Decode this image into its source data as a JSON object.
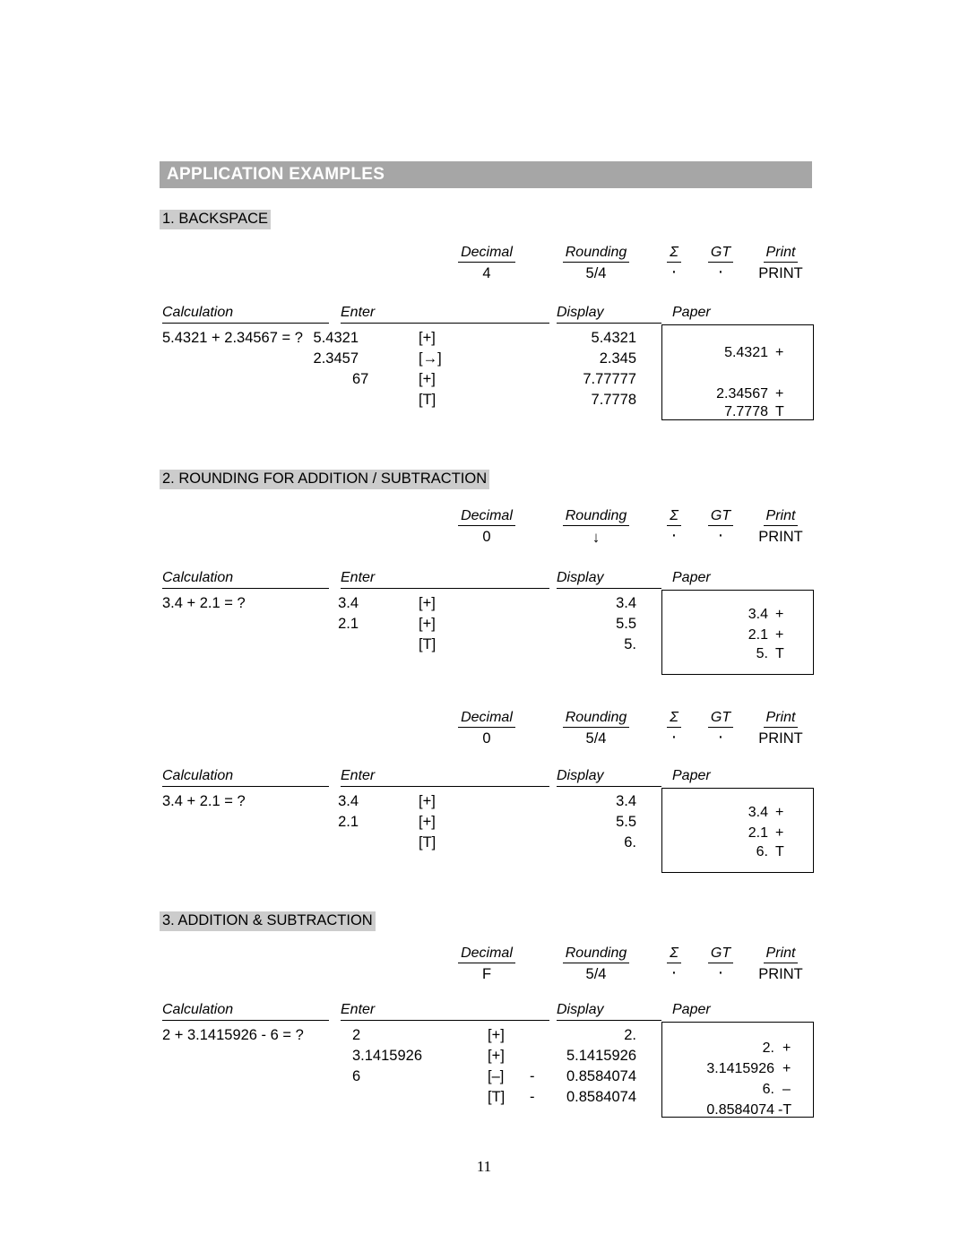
{
  "banner": {
    "title": "APPLICATION EXAMPLES"
  },
  "page_number": "11",
  "column_headers": {
    "calculation": "Calculation",
    "enter": "Enter",
    "display": "Display",
    "paper": "Paper"
  },
  "settings_headers": {
    "decimal": "Decimal",
    "rounding": "Rounding",
    "sigma": "Σ",
    "gt": "GT",
    "print": "Print"
  },
  "sections": [
    {
      "heading": "1. BACKSPACE",
      "blocks": [
        {
          "settings": {
            "decimal": "4",
            "rounding": "5/4",
            "sigma": "·",
            "gt": "·",
            "print": "PRINT"
          },
          "calculation": "5.4321 + 2.34567 = ?",
          "rows": [
            {
              "enter": "5.4321",
              "key": "[+]",
              "display": "5.4321"
            },
            {
              "enter": "2.3457",
              "key": "[→]",
              "display": "2.345"
            },
            {
              "enter": "67",
              "key": "[+]",
              "display": "7.77777"
            },
            {
              "enter": "",
              "key": "[T]",
              "display": "7.7778"
            }
          ],
          "paper": [
            {
              "num": "5.4321",
              "sym": "+"
            },
            {
              "num": "",
              "sym": ""
            },
            {
              "num": "2.34567",
              "sym": "+"
            },
            {
              "num": "7.7778",
              "sym": "T"
            }
          ]
        }
      ]
    },
    {
      "heading": "2. ROUNDING FOR ADDITION / SUBTRACTION",
      "blocks": [
        {
          "settings": {
            "decimal": "0",
            "rounding": "↓",
            "sigma": "·",
            "gt": "·",
            "print": "PRINT"
          },
          "calculation": "3.4 + 2.1 = ?",
          "rows": [
            {
              "enter": "3.4",
              "key": "[+]",
              "display": "3.4"
            },
            {
              "enter": "2.1",
              "key": "[+]",
              "display": "5.5"
            },
            {
              "enter": "",
              "key": "[T]",
              "display": "5."
            }
          ],
          "paper": [
            {
              "num": "3.4",
              "sym": "+"
            },
            {
              "num": "2.1",
              "sym": "+"
            },
            {
              "num": "5.",
              "sym": "T"
            }
          ]
        },
        {
          "settings": {
            "decimal": "0",
            "rounding": "5/4",
            "sigma": "·",
            "gt": "·",
            "print": "PRINT"
          },
          "calculation": "3.4 + 2.1 = ?",
          "rows": [
            {
              "enter": "3.4",
              "key": "[+]",
              "display": "3.4"
            },
            {
              "enter": "2.1",
              "key": "[+]",
              "display": "5.5"
            },
            {
              "enter": "",
              "key": "[T]",
              "display": "6."
            }
          ],
          "paper": [
            {
              "num": "3.4",
              "sym": "+"
            },
            {
              "num": "2.1",
              "sym": "+"
            },
            {
              "num": "6.",
              "sym": "T"
            }
          ]
        }
      ]
    },
    {
      "heading": "3. ADDITION & SUBTRACTION",
      "blocks": [
        {
          "settings": {
            "decimal": "F",
            "rounding": "5/4",
            "sigma": "·",
            "gt": "·",
            "print": "PRINT"
          },
          "calculation": "2 + 3.1415926 - 6 = ?",
          "rows": [
            {
              "enter": "2",
              "key": "[+]",
              "display": "2."
            },
            {
              "enter": "3.1415926",
              "key": "[+]",
              "display": "5.1415926",
              "display_sign": "-"
            },
            {
              "enter": "6",
              "key": "[–]",
              "display": "0.8584074",
              "display_sign": "-"
            },
            {
              "enter": "",
              "key": "[T]",
              "display": "0.8584074",
              "display_sign": "-"
            }
          ],
          "paper": [
            {
              "num": "2.",
              "sym": "+"
            },
            {
              "num": "3.1415926",
              "sym": "+"
            },
            {
              "num": "6.",
              "sym": "–"
            },
            {
              "num": "0.8584074",
              "sym": "-T"
            }
          ]
        }
      ]
    }
  ]
}
